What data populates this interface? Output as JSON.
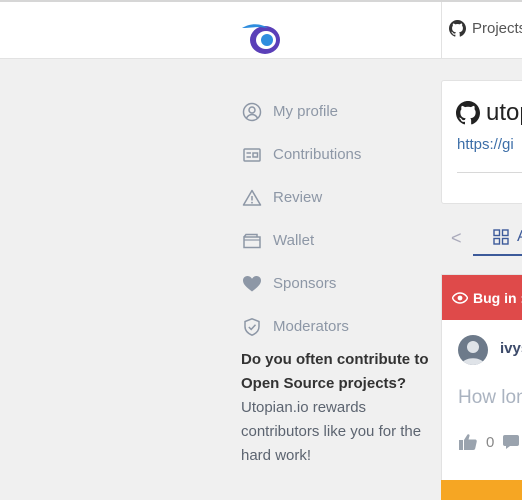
{
  "header": {
    "projects_label": "Projects"
  },
  "menu": {
    "items": [
      {
        "label": "My profile",
        "icon": "user-circle-icon"
      },
      {
        "label": "Contributions",
        "icon": "card-icon"
      },
      {
        "label": "Review",
        "icon": "warning-icon"
      },
      {
        "label": "Wallet",
        "icon": "wallet-icon"
      },
      {
        "label": "Sponsors",
        "icon": "heart-icon"
      },
      {
        "label": "Moderators",
        "icon": "shield-check-icon"
      }
    ]
  },
  "cta": {
    "question": "Do you often contribute to Open Source projects?",
    "text": "Utopian.io rewards contributors like you for the hard work!"
  },
  "project_card": {
    "title": "utop",
    "link": "https://gi"
  },
  "tabs": {
    "back": "<",
    "active": "A"
  },
  "post": {
    "category": "Bug in :",
    "username": "ivys",
    "title": "How lon",
    "likes": "0"
  },
  "colors": {
    "bug_red": "#df4a4a",
    "accent_blue": "#3c5a9a",
    "orange": "#f6a623"
  }
}
